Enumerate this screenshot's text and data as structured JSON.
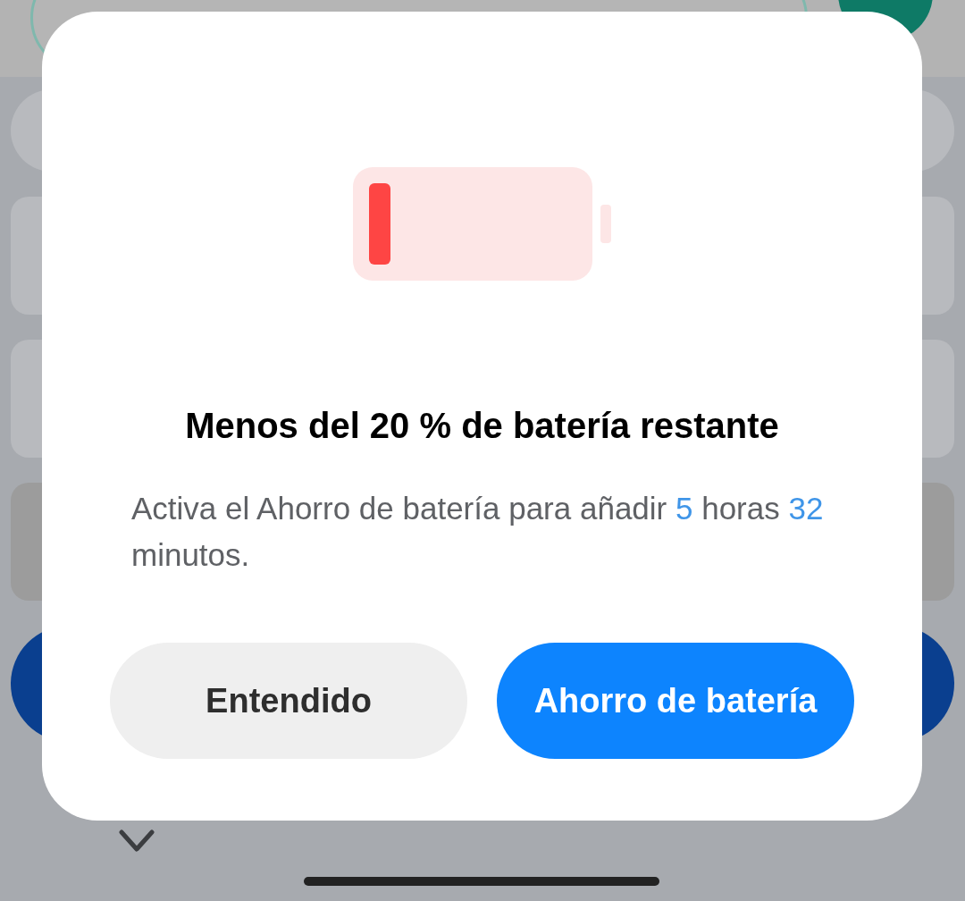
{
  "dialog": {
    "title": "Menos del 20 % de batería restante",
    "message_parts": [
      {
        "text": "Activa el Ahorro de batería para añadir ",
        "kind": "plain"
      },
      {
        "text": "5",
        "kind": "highlight"
      },
      {
        "text": " horas ",
        "kind": "plain"
      },
      {
        "text": "32",
        "kind": "highlight"
      },
      {
        "text": " minutos.",
        "kind": "plain"
      }
    ],
    "buttons": [
      {
        "label": "Entendido",
        "kind": "secondary"
      },
      {
        "label": "Ahorro de batería",
        "kind": "primary"
      }
    ]
  }
}
